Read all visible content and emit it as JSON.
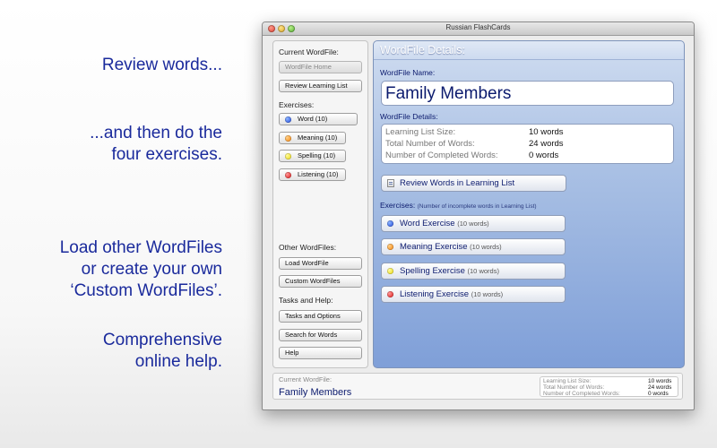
{
  "promo": {
    "line1": "Review words...",
    "line2a": "...and then do the",
    "line2b": "four exercises.",
    "line3a": "Load other WordFiles",
    "line3b": "or create your own",
    "line3c": "‘Custom WordFiles’.",
    "line4a": "Comprehensive",
    "line4b": "online help."
  },
  "window": {
    "title": "Russian FlashCards"
  },
  "sidebar": {
    "current_label": "Current WordFile:",
    "wordfile_home": "WordFile Home",
    "review_learning_list": "Review Learning List",
    "exercises_label": "Exercises:",
    "exercises": [
      {
        "label": "Word (10)",
        "color": "#1740d6"
      },
      {
        "label": "Meaning (10)",
        "color": "#f07a00"
      },
      {
        "label": "Spelling (10)",
        "color": "#e6d400"
      },
      {
        "label": "Listening (10)",
        "color": "#d60c0c"
      }
    ],
    "other_label": "Other WordFiles:",
    "load_wordfile": "Load WordFile",
    "custom_wordfiles": "Custom WordFiles",
    "tasks_label": "Tasks and Help:",
    "tasks_options": "Tasks and Options",
    "search_words": "Search for Words",
    "help": "Help"
  },
  "panel": {
    "header": "WordFile Details:",
    "name_label": "WordFile Name:",
    "name_value": "Family Members",
    "details_label": "WordFile Details:",
    "details": [
      {
        "key": "Learning List Size:",
        "value": "10 words"
      },
      {
        "key": "Total Number of Words:",
        "value": "24 words"
      },
      {
        "key": "Number of Completed Words:",
        "value": "0 words"
      }
    ],
    "review_button": "Review Words in Learning List",
    "exercises_label": "Exercises:",
    "exercises_note": "(Number of incomplete words in Learning List)",
    "exercise_buttons": [
      {
        "label": "Word Exercise",
        "count": "(10 words)"
      },
      {
        "label": "Meaning Exercise",
        "count": "(10 words)"
      },
      {
        "label": "Spelling Exercise",
        "count": "(10 words)"
      },
      {
        "label": "Listening Exercise",
        "count": "(10 words)"
      }
    ]
  },
  "status": {
    "current_label": "Current WordFile:",
    "current_name": "Family Members",
    "details": [
      {
        "key": "Learning List Size:",
        "value": "10 words"
      },
      {
        "key": "Total Number of Words:",
        "value": "24 words"
      },
      {
        "key": "Number of Completed Words:",
        "value": "0 words"
      }
    ]
  },
  "colors": {
    "accent_text": "#1a2a9c",
    "panel_blue": "#7f9fd8"
  }
}
